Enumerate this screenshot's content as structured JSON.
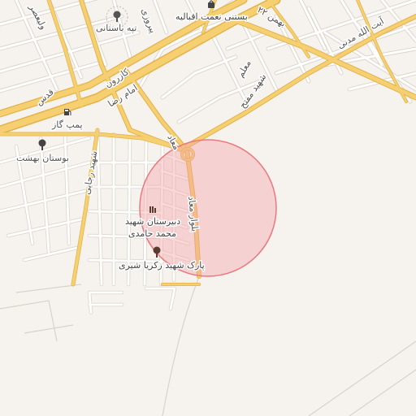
{
  "map": {
    "labels": {
      "tappe_bastani": "تپه باستانی",
      "basti_nemat": "بستنی نعمت اقبالیه",
      "pirouzi": "پیروزی",
      "vali_asr": "ولیعصر",
      "bahman22": "۲۲ بهمن",
      "ayatollah_madani": "آیت الله مدنی",
      "ghods": "قدس",
      "kazerun": "کازرون",
      "imam_reza": "امام رضا",
      "moallem": "معلم",
      "shahid_moftah": "شهید مفتح",
      "pump_gas": "پمپ گاز",
      "bostan_behesht": "بوستان بهشت",
      "shahid_rajaei": "شهید رجایی",
      "maad": "معاد",
      "blvd_maad": "بلوار معاد",
      "school_line1": "دبیرستان شهید",
      "school_line2": "محمد حامدی",
      "park": "پارک شهید زکریا شیری"
    },
    "icons": {
      "hill": "tree-icon",
      "ice_cream": "shopping-bag-icon",
      "fuel": "fuel-pump-icon",
      "garden": "tree-icon",
      "school": "school-icon",
      "park": "tree-icon"
    },
    "colors": {
      "background": "#f6f3ef",
      "major_road": "#f6cf70",
      "minor_road": "#ffffff",
      "highlight_fill": "#f4a3a8",
      "highlight_stroke": "#e9797f"
    }
  }
}
